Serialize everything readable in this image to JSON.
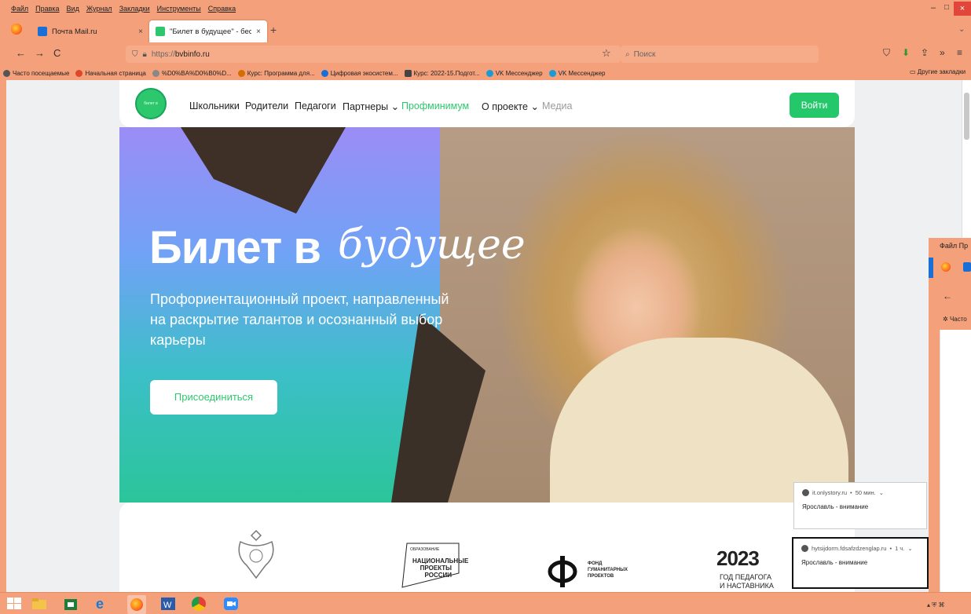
{
  "menu": [
    "Файл",
    "Правка",
    "Вид",
    "Журнал",
    "Закладки",
    "Инструменты",
    "Справка"
  ],
  "window_controls": {
    "minimize": "–",
    "maximize": "□",
    "close": "×"
  },
  "tabs": [
    {
      "title": "Почта Mail.ru",
      "close": "×",
      "icon": "mail-icon",
      "color": "#1a6fd6"
    },
    {
      "title": "\"Билет в будущее\" - бесплатн",
      "close": "×",
      "icon": "bvb-favicon",
      "color": "#2dc86e"
    }
  ],
  "new_tab": "+",
  "nav": {
    "back": "←",
    "forward": "→",
    "reload": "C",
    "url_scheme": "https://",
    "url_host": "bvbinfo.ru",
    "star": "☆",
    "search_placeholder": "Поиск"
  },
  "toolbar_icons": [
    "pocket-icon",
    "download-icon",
    "share-icon",
    "more-icon",
    "menu-icon"
  ],
  "bookmarks": [
    {
      "label": "Часто посещаемые",
      "color": "#555"
    },
    {
      "label": "Начальная страница",
      "color": "#e0472a"
    },
    {
      "label": "%D0%BA%D0%B0%D...",
      "color": "#666"
    },
    {
      "label": "Курс: Программа для...",
      "color": "#d36e00"
    },
    {
      "label": "Цифровая экосистем...",
      "color": "#1a6fd6"
    },
    {
      "label": "Курс: 2022-15.Подгот...",
      "color": "#444"
    },
    {
      "label": "VK Мессенджер",
      "color": "#1a9bd6"
    },
    {
      "label": "VK Мессенджер",
      "color": "#1a9bd6"
    }
  ],
  "other_bookmarks": "Другие закладки",
  "site": {
    "logo_text": "билет в будущее",
    "nav": [
      "Школьники",
      "Родители",
      "Педагоги",
      "Партнеры ⌄",
      "Профминимум",
      "О проекте ⌄",
      "Медиа"
    ],
    "login": "Войти",
    "hero_title_bold": "Билет в",
    "hero_title_italic": "будущее",
    "hero_subtitle": "Профориентационный проект, направленный на раскрытие талантов и осознанный выбор карьеры",
    "join": "Присоединиться",
    "partners": {
      "np_title": "ОБРАЗОВАНИЕ",
      "np_text": "НАЦИОНАЛЬНЫЕ ПРОЕКТЫ РОССИИ",
      "fond_text": "ФОНД ГУМАНИТАРНЫХ ПРОЕКТОВ",
      "year": "2023",
      "year_text": "ГОД ПЕДАГОГА И НАСТАВНИКА"
    }
  },
  "right_window": {
    "menu": "Файл Пр",
    "bookmark": "Часто"
  },
  "notifications": [
    {
      "source": "it.onlystory.ru",
      "time": "50 мин.",
      "text": "Ярославль - внимание"
    },
    {
      "source": "hytsijdorm.fdsafzdzenglap.ru",
      "time": "1 ч.",
      "text": "Ярославль - внимание"
    }
  ]
}
